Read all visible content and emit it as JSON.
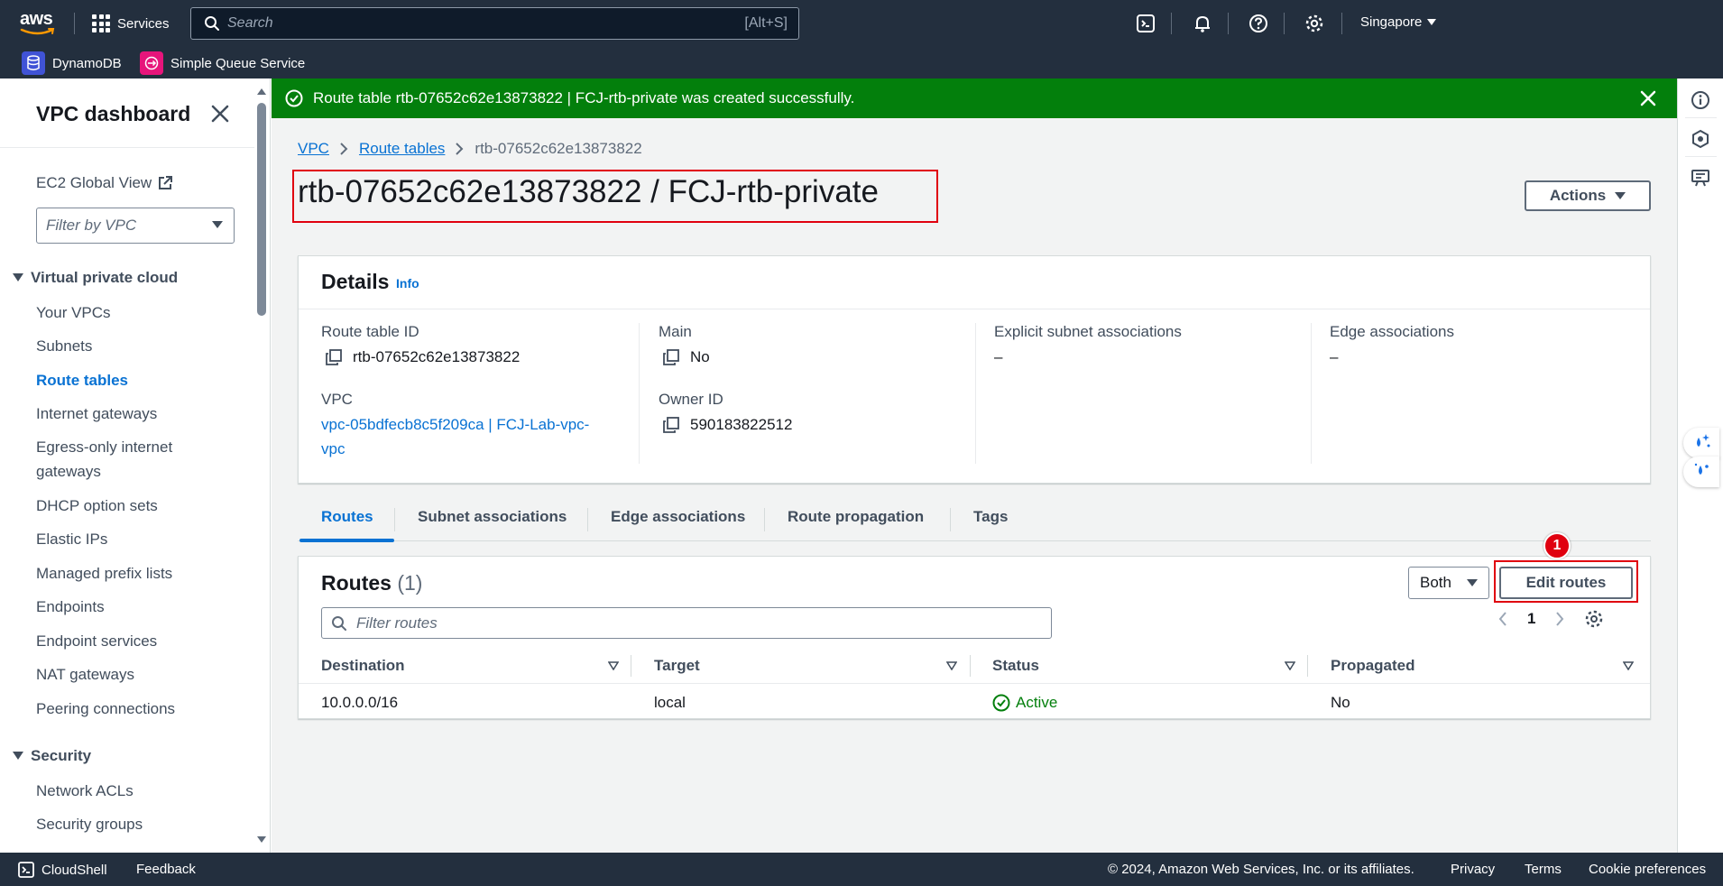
{
  "topnav": {
    "logo_text": "aws",
    "services_label": "Services",
    "search_placeholder": "Search",
    "search_shortcut": "[Alt+S]",
    "region": "Singapore",
    "icons": [
      "cloudshell-icon",
      "notifications-icon",
      "help-icon",
      "settings-icon"
    ]
  },
  "favorites": [
    {
      "label": "DynamoDB",
      "color": "#4053d6"
    },
    {
      "label": "Simple Queue Service",
      "color": "#e7157b"
    }
  ],
  "sidebar": {
    "title": "VPC dashboard",
    "ec2_global_view": "EC2 Global View",
    "filter_placeholder": "Filter by VPC",
    "section_vpc": "Virtual private cloud",
    "vpc_items": [
      "Your VPCs",
      "Subnets",
      "Route tables",
      "Internet gateways",
      "Egress-only internet",
      "gateways",
      "DHCP option sets",
      "Elastic IPs",
      "Managed prefix lists",
      "Endpoints",
      "Endpoint services",
      "NAT gateways",
      "Peering connections"
    ],
    "active_item": "Route tables",
    "section_security": "Security",
    "security_items": [
      "Network ACLs",
      "Security groups"
    ]
  },
  "flash": {
    "message": "Route table rtb-07652c62e13873822 | FCJ-rtb-private was created successfully.",
    "color": "#037f0c"
  },
  "breadcrumb": {
    "items": [
      "VPC",
      "Route tables"
    ],
    "current": "rtb-07652c62e13873822"
  },
  "page": {
    "title": "rtb-07652c62e13873822 / FCJ-rtb-private",
    "actions_label": "Actions"
  },
  "details": {
    "heading": "Details",
    "info": "Info",
    "route_table_id_label": "Route table ID",
    "route_table_id": "rtb-07652c62e13873822",
    "vpc_label": "VPC",
    "vpc_line1": "vpc-05bdfecb8c5f209ca | FCJ-Lab-vpc-",
    "vpc_line2": "vpc",
    "main_label": "Main",
    "main_value": "No",
    "owner_label": "Owner ID",
    "owner_value": "590183822512",
    "explicit_label": "Explicit subnet associations",
    "explicit_value": "–",
    "edge_label": "Edge associations",
    "edge_value": "–"
  },
  "tabs": [
    "Routes",
    "Subnet associations",
    "Edge associations",
    "Route propagation",
    "Tags"
  ],
  "routes": {
    "title": "Routes",
    "count": "(1)",
    "both_label": "Both",
    "edit_label": "Edit routes",
    "step_number": "1",
    "filter_placeholder": "Filter routes",
    "page_number": "1",
    "columns": [
      "Destination",
      "Target",
      "Status",
      "Propagated"
    ],
    "rows": [
      {
        "destination": "10.0.0.0/16",
        "target": "local",
        "status": "Active",
        "propagated": "No"
      }
    ]
  },
  "footer": {
    "cloudshell": "CloudShell",
    "feedback": "Feedback",
    "copyright": "© 2024, Amazon Web Services, Inc. or its affiliates.",
    "privacy": "Privacy",
    "terms": "Terms",
    "cookies": "Cookie preferences"
  },
  "colors": {
    "nav_bg": "#232f3e",
    "link": "#0972d3",
    "highlight": "#e0000f",
    "success": "#037f0c"
  }
}
